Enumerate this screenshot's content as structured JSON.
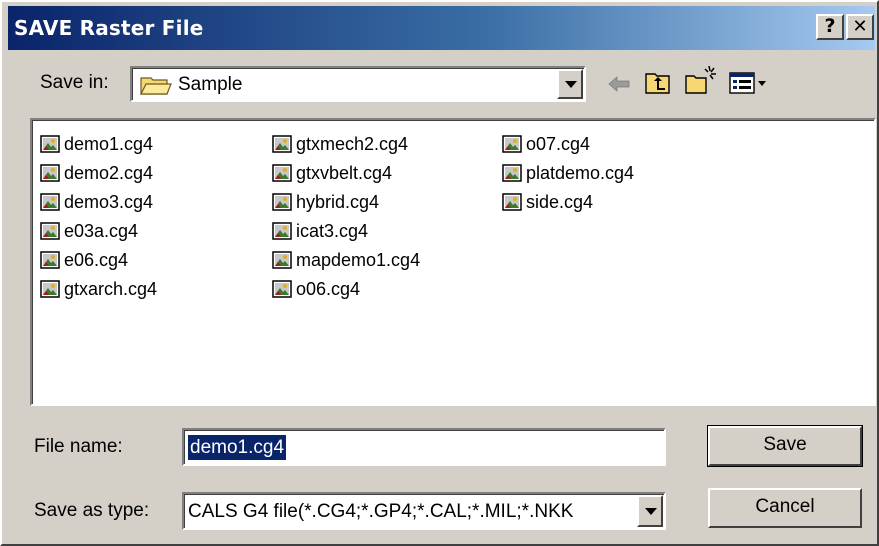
{
  "window": {
    "title": "SAVE Raster File",
    "help_label": "?",
    "close_label": "✕"
  },
  "save_in": {
    "label": "Save in:",
    "value": "Sample"
  },
  "toolbar": {
    "icons": [
      "back-arrow-icon",
      "up-folder-icon",
      "new-folder-icon",
      "view-menu-icon"
    ]
  },
  "files": {
    "columns": [
      [
        "demo1.cg4",
        "demo2.cg4",
        "demo3.cg4",
        "e03a.cg4",
        "e06.cg4",
        "gtxarch.cg4"
      ],
      [
        "gtxmech2.cg4",
        "gtxvbelt.cg4",
        "hybrid.cg4",
        "icat3.cg4",
        "mapdemo1.cg4",
        "o06.cg4"
      ],
      [
        "o07.cg4",
        "platdemo.cg4",
        "side.cg4"
      ]
    ]
  },
  "file_name": {
    "label": "File name:",
    "value": "demo1.cg4"
  },
  "save_as_type": {
    "label": "Save as type:",
    "value": "CALS G4 file(*.CG4;*.GP4;*.CAL;*.MIL;*.NKK"
  },
  "buttons": {
    "save": "Save",
    "cancel": "Cancel"
  },
  "colors": {
    "title_start": "#0a246a",
    "title_end": "#a6caf0",
    "face": "#d4d0c8",
    "selection": "#0a246a"
  }
}
